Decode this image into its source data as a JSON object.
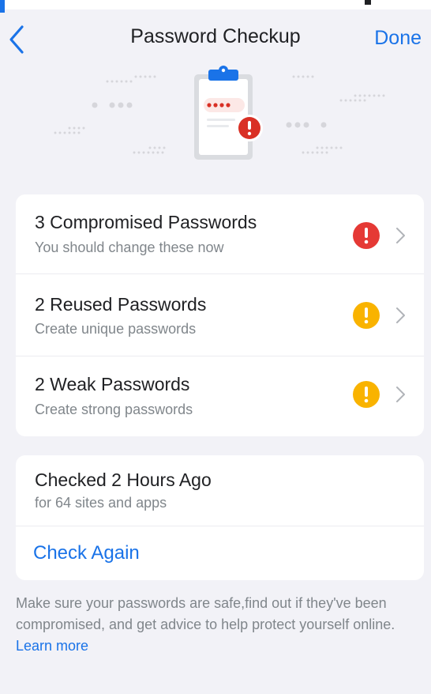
{
  "nav": {
    "back_icon": "chevron-left-icon",
    "title": "Password Checkup",
    "done_label": "Done"
  },
  "illustration": {
    "icon": "clipboard-password-alert-icon"
  },
  "issues": [
    {
      "title": "3 Compromised Passwords",
      "subtitle": "You should change these now",
      "severity": "critical",
      "color": "#e53935"
    },
    {
      "title": "2 Reused Passwords",
      "subtitle": "Create unique passwords",
      "severity": "warning",
      "color": "#f9b300"
    },
    {
      "title": "2 Weak Passwords",
      "subtitle": "Create strong passwords",
      "severity": "warning",
      "color": "#f9b300"
    }
  ],
  "status": {
    "title": "Checked 2 Hours Ago",
    "subtitle": "for 64 sites and apps",
    "action_label": "Check Again"
  },
  "footer": {
    "text": "Make sure your passwords are safe,find out if they've been compromised, and get advice to help protect yourself online. ",
    "link_label": "Learn more"
  },
  "colors": {
    "accent": "#1a73e8",
    "background": "#f2f2f7",
    "critical": "#e53935",
    "warning": "#f9b300"
  }
}
